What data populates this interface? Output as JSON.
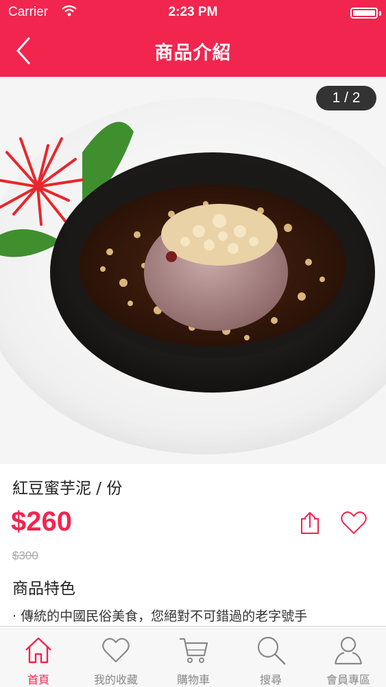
{
  "status_bar": {
    "carrier": "Carrier",
    "time": "2:23 PM"
  },
  "header": {
    "title": "商品介紹",
    "back_icon": "chevron-left-icon"
  },
  "gallery": {
    "counter": "1 / 2"
  },
  "product": {
    "name": "紅豆蜜芋泥 / 份",
    "price": "$260",
    "original_price": "$300",
    "features_title": "商品特色",
    "features_text": "· 傳統的中國民俗美食，您絕對不可錯過的老字號手"
  },
  "tabs": [
    {
      "label": "首頁",
      "icon": "home-icon",
      "active": true
    },
    {
      "label": "我的收藏",
      "icon": "heart-icon",
      "active": false
    },
    {
      "label": "購物車",
      "icon": "cart-icon",
      "active": false
    },
    {
      "label": "搜尋",
      "icon": "search-icon",
      "active": false
    },
    {
      "label": "會員專區",
      "icon": "user-icon",
      "active": false
    }
  ],
  "colors": {
    "accent": "#f2254f",
    "tab_inactive": "#888888"
  }
}
